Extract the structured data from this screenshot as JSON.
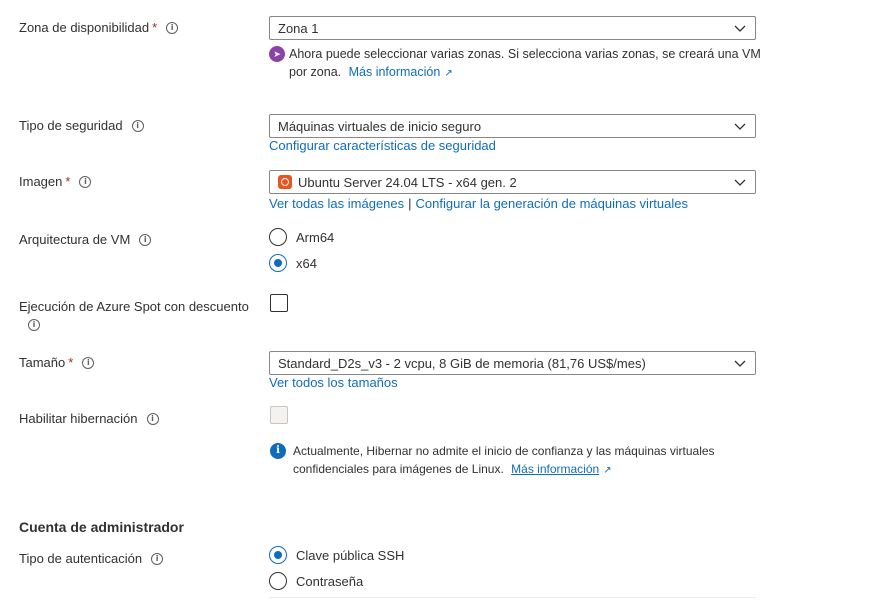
{
  "fields": {
    "zone": {
      "label": "Zona de disponibilidad",
      "required": "*",
      "value": "Zona 1",
      "note_text": "Ahora puede seleccionar varias zonas. Si selecciona varias zonas, se creará una VM",
      "note_text2": "por zona.",
      "note_link": "Más información"
    },
    "security": {
      "label": "Tipo de seguridad",
      "value": "Máquinas virtuales de inicio seguro",
      "link": "Configurar características de seguridad"
    },
    "image": {
      "label": "Imagen",
      "required": "*",
      "value": "Ubuntu Server 24.04 LTS - x64 gen. 2",
      "link1": "Ver todas las imágenes",
      "separator": "|",
      "link2": "Configurar la generación de máquinas virtuales"
    },
    "arch": {
      "label": "Arquitectura de VM",
      "options": [
        "Arm64",
        "x64"
      ],
      "selected": "x64"
    },
    "spot": {
      "label": "Ejecución de Azure Spot con descuento",
      "checked": false
    },
    "size": {
      "label": "Tamaño",
      "required": "*",
      "value": "Standard_D2s_v3 - 2 vcpu, 8 GiB de memoria (81,76 US$/mes)",
      "link": "Ver todos los tamaños"
    },
    "hibernate": {
      "label": "Habilitar hibernación",
      "checked": false,
      "disabled": true,
      "note_text": "Actualmente, Hibernar no admite el inicio de confianza y las máquinas virtuales",
      "note_text2": "confidenciales para imágenes de Linux.",
      "note_link": "Más información"
    }
  },
  "admin": {
    "section_title": "Cuenta de administrador",
    "auth_label": "Tipo de autenticación",
    "auth_options": [
      "Clave pública SSH",
      "Contraseña"
    ],
    "auth_selected": "Clave pública SSH"
  },
  "icons": {
    "info": "info-icon",
    "chevron": "chevron-down-icon",
    "external": "external-link-icon",
    "rocket": "rocket-icon",
    "ubuntu": "ubuntu-logo-icon"
  },
  "colors": {
    "link": "#0f6cbd",
    "required": "#a4262c",
    "radio_selected": "#0f6cbd",
    "rocket_badge": "#8a43a8",
    "ubuntu": "#e95420"
  }
}
